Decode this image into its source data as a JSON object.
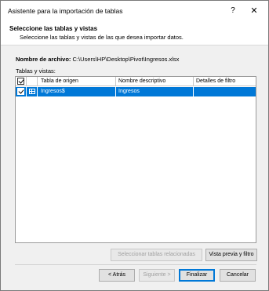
{
  "window": {
    "title": "Asistente para la importación de tablas",
    "help_glyph": "?",
    "close_glyph": "✕"
  },
  "header": {
    "title": "Seleccione las tablas y vistas",
    "subtitle": "Seleccione las tablas y vistas de las que desea importar datos."
  },
  "file": {
    "label": "Nombre de archivo:",
    "path": "C:\\Users\\HP\\Desktop\\Pivot\\Ingresos.xlsx"
  },
  "tables_label": "Tablas y vistas:",
  "grid": {
    "columns": [
      "Tabla de origen",
      "Nombre descriptivo",
      "Detalles de filtro"
    ],
    "header_checked": true,
    "rows": [
      {
        "checked": true,
        "source": "Ingresos$",
        "friendly_name": "Ingresos",
        "filter": "",
        "selected": true
      }
    ]
  },
  "buttons": {
    "select_related": "Seleccionar tablas relacionadas",
    "preview_filter": "Vista previa y filtro",
    "back": "< Atrás",
    "next": "Siguiente >",
    "finish": "Finalizar",
    "cancel": "Cancelar"
  },
  "colors": {
    "selection": "#0078d7"
  }
}
